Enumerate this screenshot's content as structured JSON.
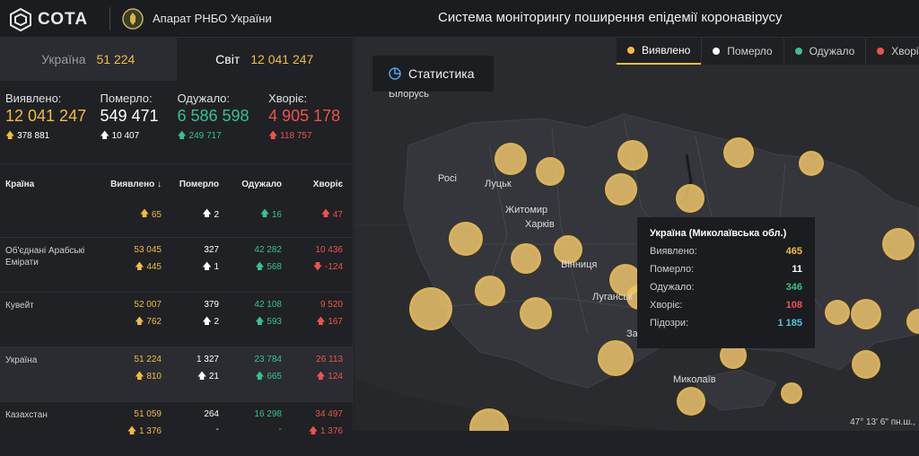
{
  "header": {
    "logo_text": "СОТА",
    "organization": "Апарат РНБО України",
    "title": "Система моніторингу поширення епідемії коронавірусу"
  },
  "tabs": [
    {
      "label": "Україна",
      "value": "51 224"
    },
    {
      "label": "Світ",
      "value": "12 041 247"
    }
  ],
  "totals": [
    {
      "label": "Виявлено:",
      "value": "12 041 247",
      "delta": "378 881",
      "color": "#f2bd3c"
    },
    {
      "label": "Померло:",
      "value": "549 471",
      "delta": "10 407",
      "color": "#ffffff"
    },
    {
      "label": "Одужало:",
      "value": "6 586 598",
      "delta": "249 717",
      "color": "#36c28b"
    },
    {
      "label": "Хворіє:",
      "value": "4 905 178",
      "delta": "118 757",
      "color": "#f0524a"
    }
  ],
  "table": {
    "headers": [
      "Країна",
      "Виявлено",
      "Померло",
      "Одужало",
      "Хворіє"
    ],
    "partial_row": {
      "detected_delta": "65",
      "died_delta": "2",
      "recovered_delta": "16",
      "sick_delta": "47"
    },
    "rows": [
      {
        "country": "Об'єднані Арабські Емірати",
        "detected": "53 045",
        "detected_delta": "445",
        "died": "327",
        "died_delta": "1",
        "recovered": "42 282",
        "recovered_delta": "568",
        "sick": "10 436",
        "sick_delta": "-124"
      },
      {
        "country": "Кувейт",
        "detected": "52 007",
        "detected_delta": "762",
        "died": "379",
        "died_delta": "2",
        "recovered": "42 108",
        "recovered_delta": "593",
        "sick": "9 520",
        "sick_delta": "167"
      },
      {
        "country": "Україна",
        "detected": "51 224",
        "detected_delta": "810",
        "died": "1 327",
        "died_delta": "21",
        "recovered": "23 784",
        "recovered_delta": "665",
        "sick": "26 113",
        "sick_delta": "124"
      },
      {
        "country": "Казахстан",
        "detected": "51 059",
        "detected_delta": "1 376",
        "died": "264",
        "died_delta": "-",
        "recovered": "16 298",
        "recovered_delta": "-",
        "sick": "34 497",
        "sick_delta": "1 376"
      }
    ]
  },
  "map": {
    "stat_button": "Статистика",
    "legend": [
      {
        "label": "Виявлено",
        "color": "#f2bd3c"
      },
      {
        "label": "Померло",
        "color": "#ffffff"
      },
      {
        "label": "Одужало",
        "color": "#36c28b"
      },
      {
        "label": "Хворіє",
        "color": "#f0524a"
      }
    ],
    "labels": {
      "belarus": "Білорусь",
      "russia": "Росі",
      "lutsk": "Луцьк",
      "zhytomyr": "Житомир",
      "kharkiv": "Харків",
      "vinnytsia": "Вінниця",
      "luhansk": "Луганськ",
      "mykolaiv": "Миколаїв",
      "zap": "За"
    },
    "coords": "47° 13' 6\" пн.ш.,",
    "tooltip": {
      "title": "Україна (Миколаївська обл.)",
      "rows": [
        {
          "label": "Виявлено:",
          "value": "465"
        },
        {
          "label": "Померло:",
          "value": "11"
        },
        {
          "label": "Одужало:",
          "value": "346"
        },
        {
          "label": "Хворіє:",
          "value": "108"
        },
        {
          "label": "Підозри:",
          "value": "1 185"
        }
      ]
    }
  }
}
